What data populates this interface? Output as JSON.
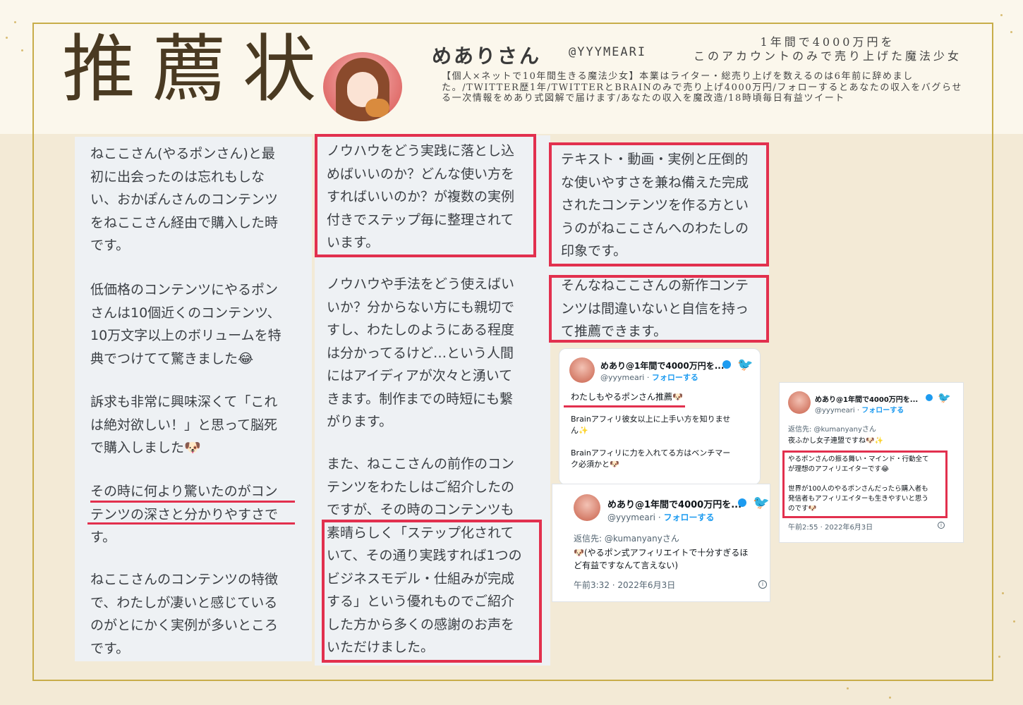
{
  "header": {
    "title": "推薦状",
    "name": "めありさん",
    "handle": "@YYYMEARI",
    "tagline": "1年間で4000万円を\nこのアカウントのみで売り上げた魔法少女",
    "bio": "【個人×ネットで10年間生きる魔法少女】本業はライター・総売り上げを数えるのは6年前に辞めました。/TWITTER歴1年/TWITTERとBRAINのみで売り上げ4000万円/フォローするとあなたの収入をバグらせる一次情報をめあり式図解で届けます/あなたの収入を魔改造/18時頃毎日有益ツイート"
  },
  "column1": {
    "p1": "ねここさん(やるポンさん)と最\n初に出会ったのは忘れもしな\nい、おかぽんさんのコンテンツ\nをねここさん経由で購入した時\nです。",
    "p2": "低価格のコンテンツにやるポン\nさんは10個近くのコンテンツ、\n10万文字以上のボリュームを特\n典でつけてて驚きました😂",
    "p3": "訴求も非常に興味深くて「これ\nは絶対欲しい！」と思って脳死\nで購入しました🐶",
    "p4": "その時に何より驚いたのがコン\nテンツの深さと分かりやすさで\nす。",
    "p5": "ねここさんのコンテンツの特徴\nで、わたしが凄いと感じている\nのがとにかく実例が多いところ\nです。"
  },
  "column2": {
    "p1": "ノウハウをどう実践に落とし込\nめばいいのか？どんな使い方を\nすればいいのか？が複数の実例\n付きでステップ毎に整理されて\nいます。",
    "p2": "ノウハウや手法をどう使えばい\nいか？分からない方にも親切で\nすし、わたしのようにある程度\nは分かってるけど…という人間\nにはアイディアが次々と湧いて\nきます。制作までの時短にも繋\nがります。",
    "p3": "また、ねここさんの前作のコン\nテンツをわたしはご紹介したの\nですが、その時のコンテンツも\n素晴らしく「ステップ化されて\nいて、その通り実践すれば1つの\nビジネスモデル・仕組みが完成\nする」という優れものでご紹介\nした方から多くの感謝のお声を\nいただけました。"
  },
  "column3": {
    "p1": "テキスト・動画・実例と圧倒的\nな使いやすさを兼ね備えた完成\nされたコンテンツを作る方とい\nうのがねここさんへのわたしの\n印象です。",
    "p2": "そんなねここさんの新作コンテ\nンツは間違いないと自信を持っ\nて推薦できます。"
  },
  "tweet1": {
    "name": "めあり@1年間で4000万円を...",
    "handle": "@yyymeari",
    "follow": "フォローする",
    "line1": "わたしもやるポンさん推薦🐶",
    "line2": "Brainアフィリ彼女以上に上手い方を知りませ\nん✨",
    "line3": "Brainアフィリに力を入れてる方はベンチマー\nク必須かと🐶"
  },
  "tweet2": {
    "name": "めあり@1年間で4000万円を...",
    "handle": "@yyymeari",
    "follow": "フォローする",
    "reply": "返信先: @kumanyanyさん",
    "body": "🐶(やるポン式アフィリエイトで十分すぎるほ\nど有益ですなんて言えない)",
    "time": "午前3:32 · 2022年6月3日"
  },
  "tweet3": {
    "name": "めあり@1年間で4000万円を...",
    "handle": "@yyymeari",
    "follow": "フォローする",
    "reply": "返信先: @kumanyanyさん",
    "line1": "夜ふかし女子連盟ですね🐶✨",
    "line2": "やるポンさんの振る舞い・マインド・行動全て\nが理想のアフィリエイターです😂",
    "line3": "世界が100人のやるポンさんだったら購入者も\n発信者もアフィリエイターも生きやすいと思う\nのです🐶",
    "time": "午前2:55 · 2022年6月3日"
  },
  "colors": {
    "highlight": "#e2304e",
    "frame": "#c8ad4a",
    "twitter": "#1d9bf0"
  },
  "icons": [
    "avatar",
    "twitter-bird-icon",
    "verified-badge-icon",
    "info-icon"
  ]
}
